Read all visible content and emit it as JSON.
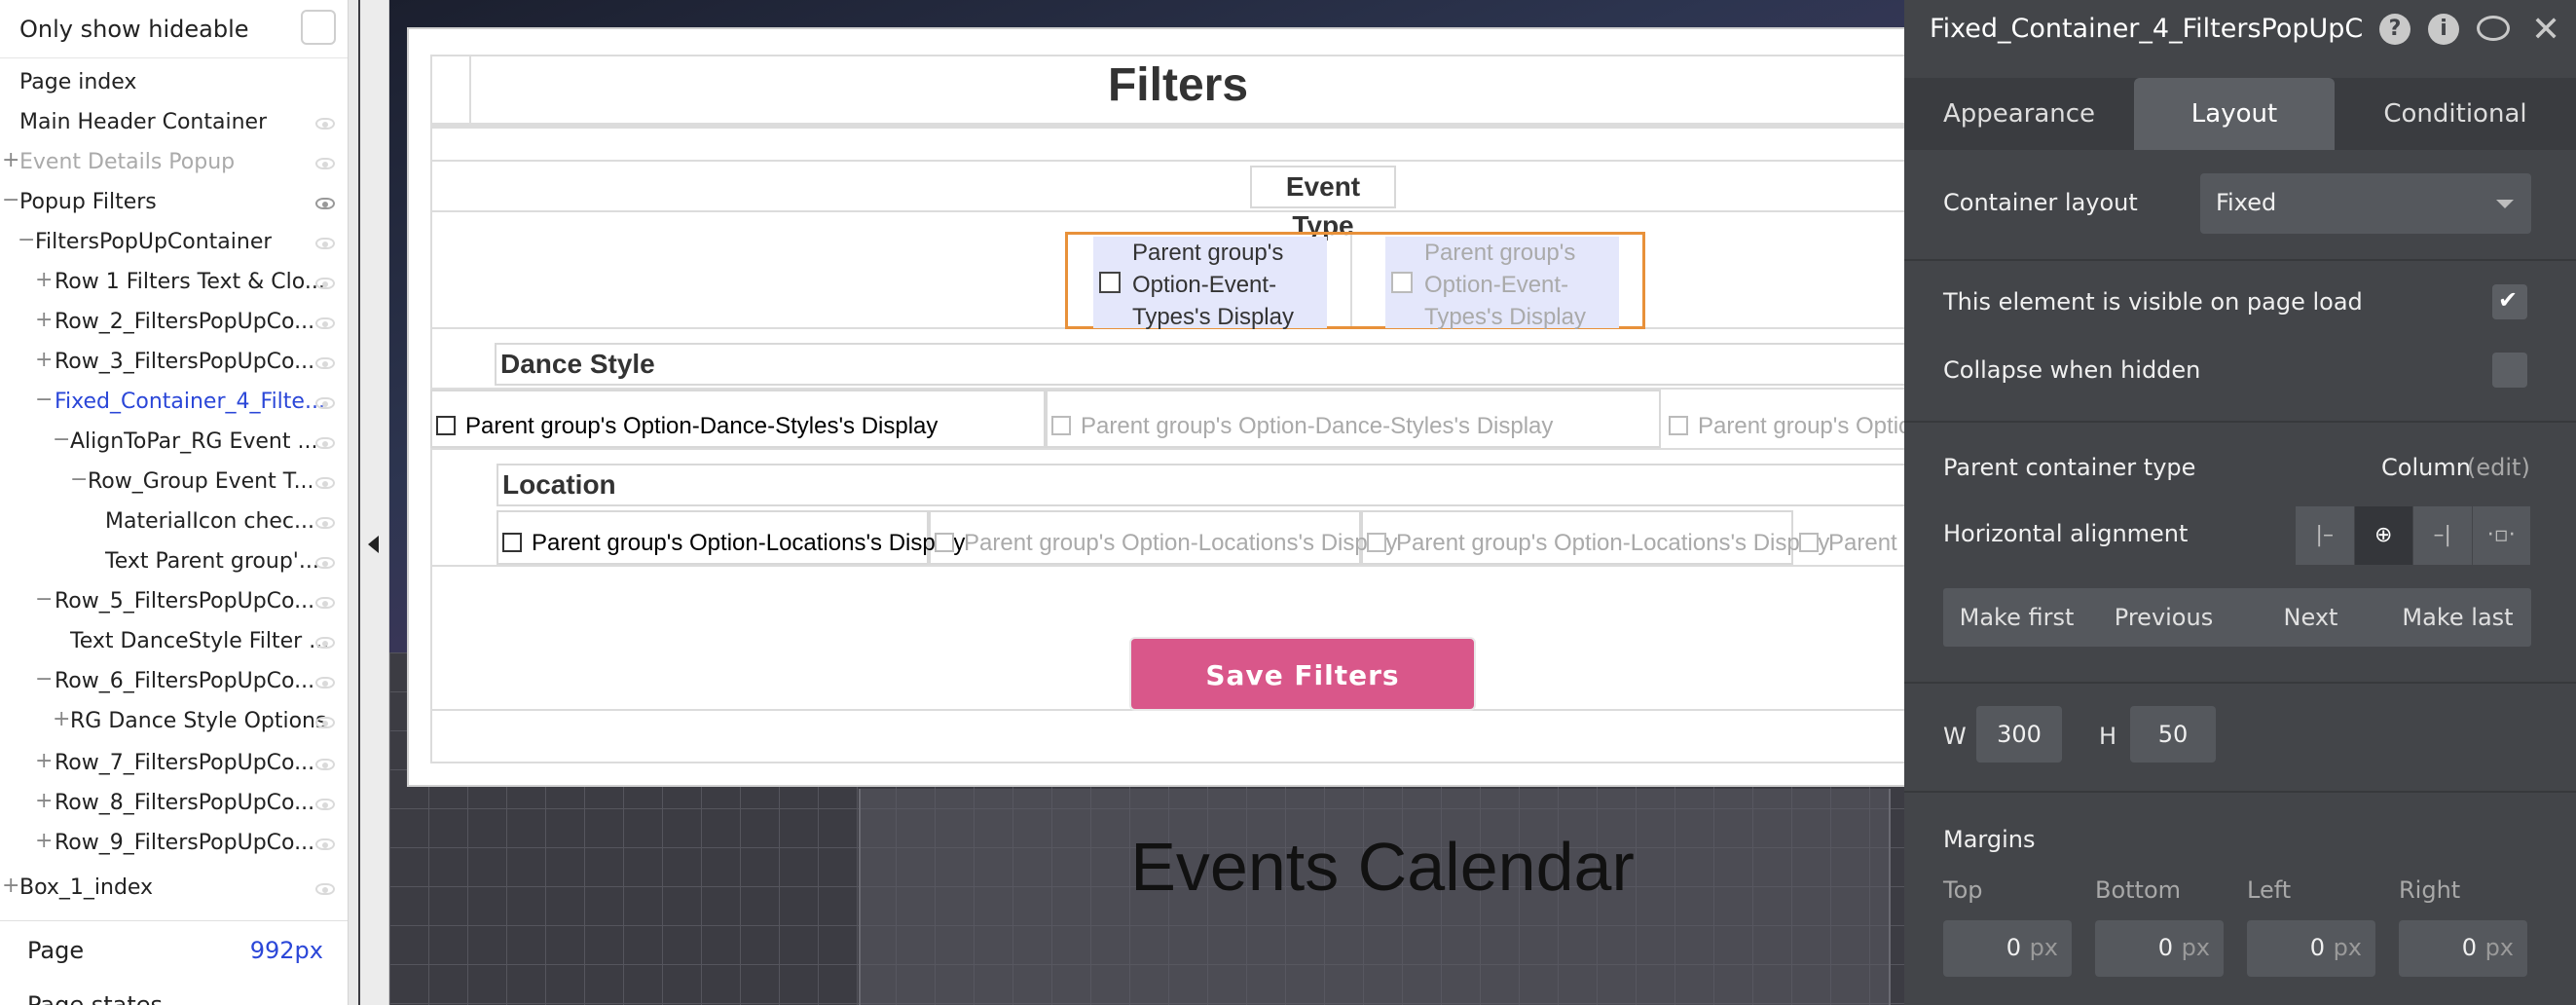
{
  "sidebar": {
    "only_hideable_label": "Only show hideable",
    "tree": [
      {
        "label": "Page index",
        "prefix": "",
        "state": "normal"
      },
      {
        "label": "Main Header Container",
        "prefix": "",
        "state": "normal"
      },
      {
        "label": "Event Details Popup",
        "prefix": "+",
        "state": "faded"
      },
      {
        "label": "Popup Filters",
        "prefix": "−",
        "state": "normal"
      },
      {
        "label": "FiltersPopUpContainer",
        "prefix": "−",
        "state": "normal"
      },
      {
        "label": "Row 1 Filters Text & Clo...",
        "prefix": "+",
        "state": "normal"
      },
      {
        "label": "Row_2_FiltersPopUpCo...",
        "prefix": "+",
        "state": "normal"
      },
      {
        "label": "Row_3_FiltersPopUpCo...",
        "prefix": "+",
        "state": "normal"
      },
      {
        "label": "Fixed_Container_4_Filte...",
        "prefix": "−",
        "state": "selected"
      },
      {
        "label": "AlignToPar_RG Event ...",
        "prefix": "−",
        "state": "normal"
      },
      {
        "label": "Row_Group Event T...",
        "prefix": "−",
        "state": "normal"
      },
      {
        "label": "MaterialIcon chec...",
        "prefix": "",
        "state": "normal"
      },
      {
        "label": "Text Parent group'...",
        "prefix": "",
        "state": "normal"
      },
      {
        "label": "Row_5_FiltersPopUpCo...",
        "prefix": "−",
        "state": "normal"
      },
      {
        "label": "Text DanceStyle Filter ...",
        "prefix": "",
        "state": "normal"
      },
      {
        "label": "Row_6_FiltersPopUpCo...",
        "prefix": "−",
        "state": "normal"
      },
      {
        "label": "RG Dance Style Options",
        "prefix": "+",
        "state": "normal"
      },
      {
        "label": "Row_7_FiltersPopUpCo...",
        "prefix": "+",
        "state": "normal"
      },
      {
        "label": "Row_8_FiltersPopUpCo...",
        "prefix": "+",
        "state": "normal"
      },
      {
        "label": "Row_9_FiltersPopUpCo...",
        "prefix": "+",
        "state": "normal"
      },
      {
        "label": "Box_1_index",
        "prefix": "+",
        "state": "normal"
      }
    ],
    "page_label": "Page",
    "page_value": "992px",
    "page_states_label": "Page states"
  },
  "canvas": {
    "popup": {
      "title": "Filters",
      "event_type_title": "Event Type",
      "event_type_options": [
        "Parent group's Option-Event-Types's Display",
        "Parent group's Option-Event-Types's Display"
      ],
      "dance_style_title": "Dance Style",
      "dance_style_options": [
        "Parent group's Option-Dance-Styles's Display",
        "Parent group's Option-Dance-Styles's Display",
        "Parent group's Optio"
      ],
      "location_title": "Location",
      "location_options": [
        "Parent group's Option-Locations's Display",
        "Parent group's Option-Locations's Display",
        "Parent group's Option-Locations's Display",
        "Parent"
      ],
      "save_button": "Save Filters"
    },
    "background_title": "Events Calendar"
  },
  "panel": {
    "element_name": "Fixed_Container_4_FiltersPopUpC",
    "header_icons": [
      "help-icon",
      "info-icon",
      "comment-icon",
      "close-icon"
    ],
    "tabs": [
      "Appearance",
      "Layout",
      "Conditional"
    ],
    "active_tab": "Layout",
    "container_layout_label": "Container layout",
    "container_layout_value": "Fixed",
    "visible_on_load_label": "This element is visible on page load",
    "visible_on_load": true,
    "collapse_hidden_label": "Collapse when hidden",
    "collapse_hidden": false,
    "parent_type_label": "Parent container type",
    "parent_type_value": "Column",
    "parent_type_edit": "(edit)",
    "halign_label": "Horizontal alignment",
    "halign_icons": [
      "align-left-icon",
      "align-center-icon",
      "align-right-icon",
      "align-distribute-icon"
    ],
    "order_buttons": [
      "Make first",
      "Previous",
      "Next",
      "Make last"
    ],
    "w_label": "W",
    "w_value": "300",
    "h_label": "H",
    "h_value": "50",
    "margins_label": "Margins",
    "margins": [
      {
        "label": "Top",
        "value": "0",
        "unit": "px"
      },
      {
        "label": "Bottom",
        "value": "0",
        "unit": "px"
      },
      {
        "label": "Left",
        "value": "0",
        "unit": "px"
      },
      {
        "label": "Right",
        "value": "0",
        "unit": "px"
      }
    ],
    "colors": {
      "panel_bg": "#434549",
      "accent_button": "#d9578a",
      "selection": "#e8913a",
      "link": "#2b47d8"
    }
  }
}
